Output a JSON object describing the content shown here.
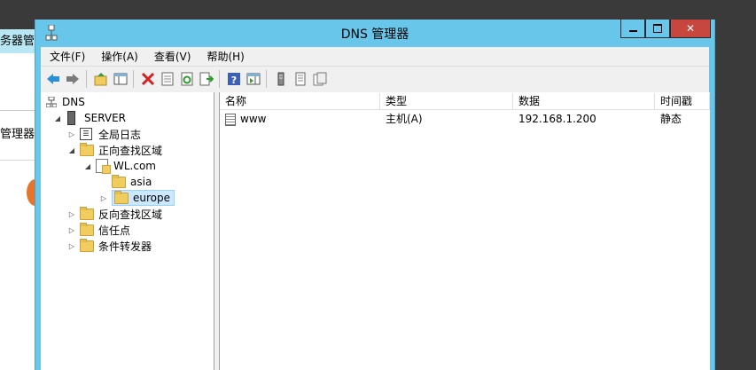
{
  "background_window": {
    "title_fragment": "务器管",
    "label_fragment": "管理器"
  },
  "window": {
    "title": "DNS 管理器",
    "controls": {
      "minimize": "–",
      "maximize": "□",
      "close": "✕"
    }
  },
  "menu": {
    "items": [
      "文件(F)",
      "操作(A)",
      "查看(V)",
      "帮助(H)"
    ]
  },
  "toolbar": {
    "icons": [
      "back-icon",
      "forward-icon",
      "up-folder-icon",
      "show-tree-icon",
      "delete-icon",
      "properties-icon",
      "refresh-icon",
      "export-icon",
      "help-icon",
      "action-pane-icon",
      "server-icon",
      "zone-icon",
      "record-icon"
    ]
  },
  "tree": {
    "root": "DNS",
    "server": "SERVER",
    "global_log": "全局日志",
    "forward_zones": "正向查找区域",
    "zone": "WL.com",
    "asia": "asia",
    "europe": "europe",
    "reverse_zones": "反向查找区域",
    "trust_points": "信任点",
    "conditional_forwarders": "条件转发器"
  },
  "list": {
    "columns": [
      "名称",
      "类型",
      "数据",
      "时间戳"
    ],
    "rows": [
      {
        "name": "www",
        "type": "主机(A)",
        "data": "192.168.1.200",
        "timestamp": "静态"
      }
    ]
  },
  "colors": {
    "titlebar": "#68c6ea",
    "close_button": "#c7463d",
    "folder": "#f1cc5f",
    "selection": "#cce8ff"
  }
}
